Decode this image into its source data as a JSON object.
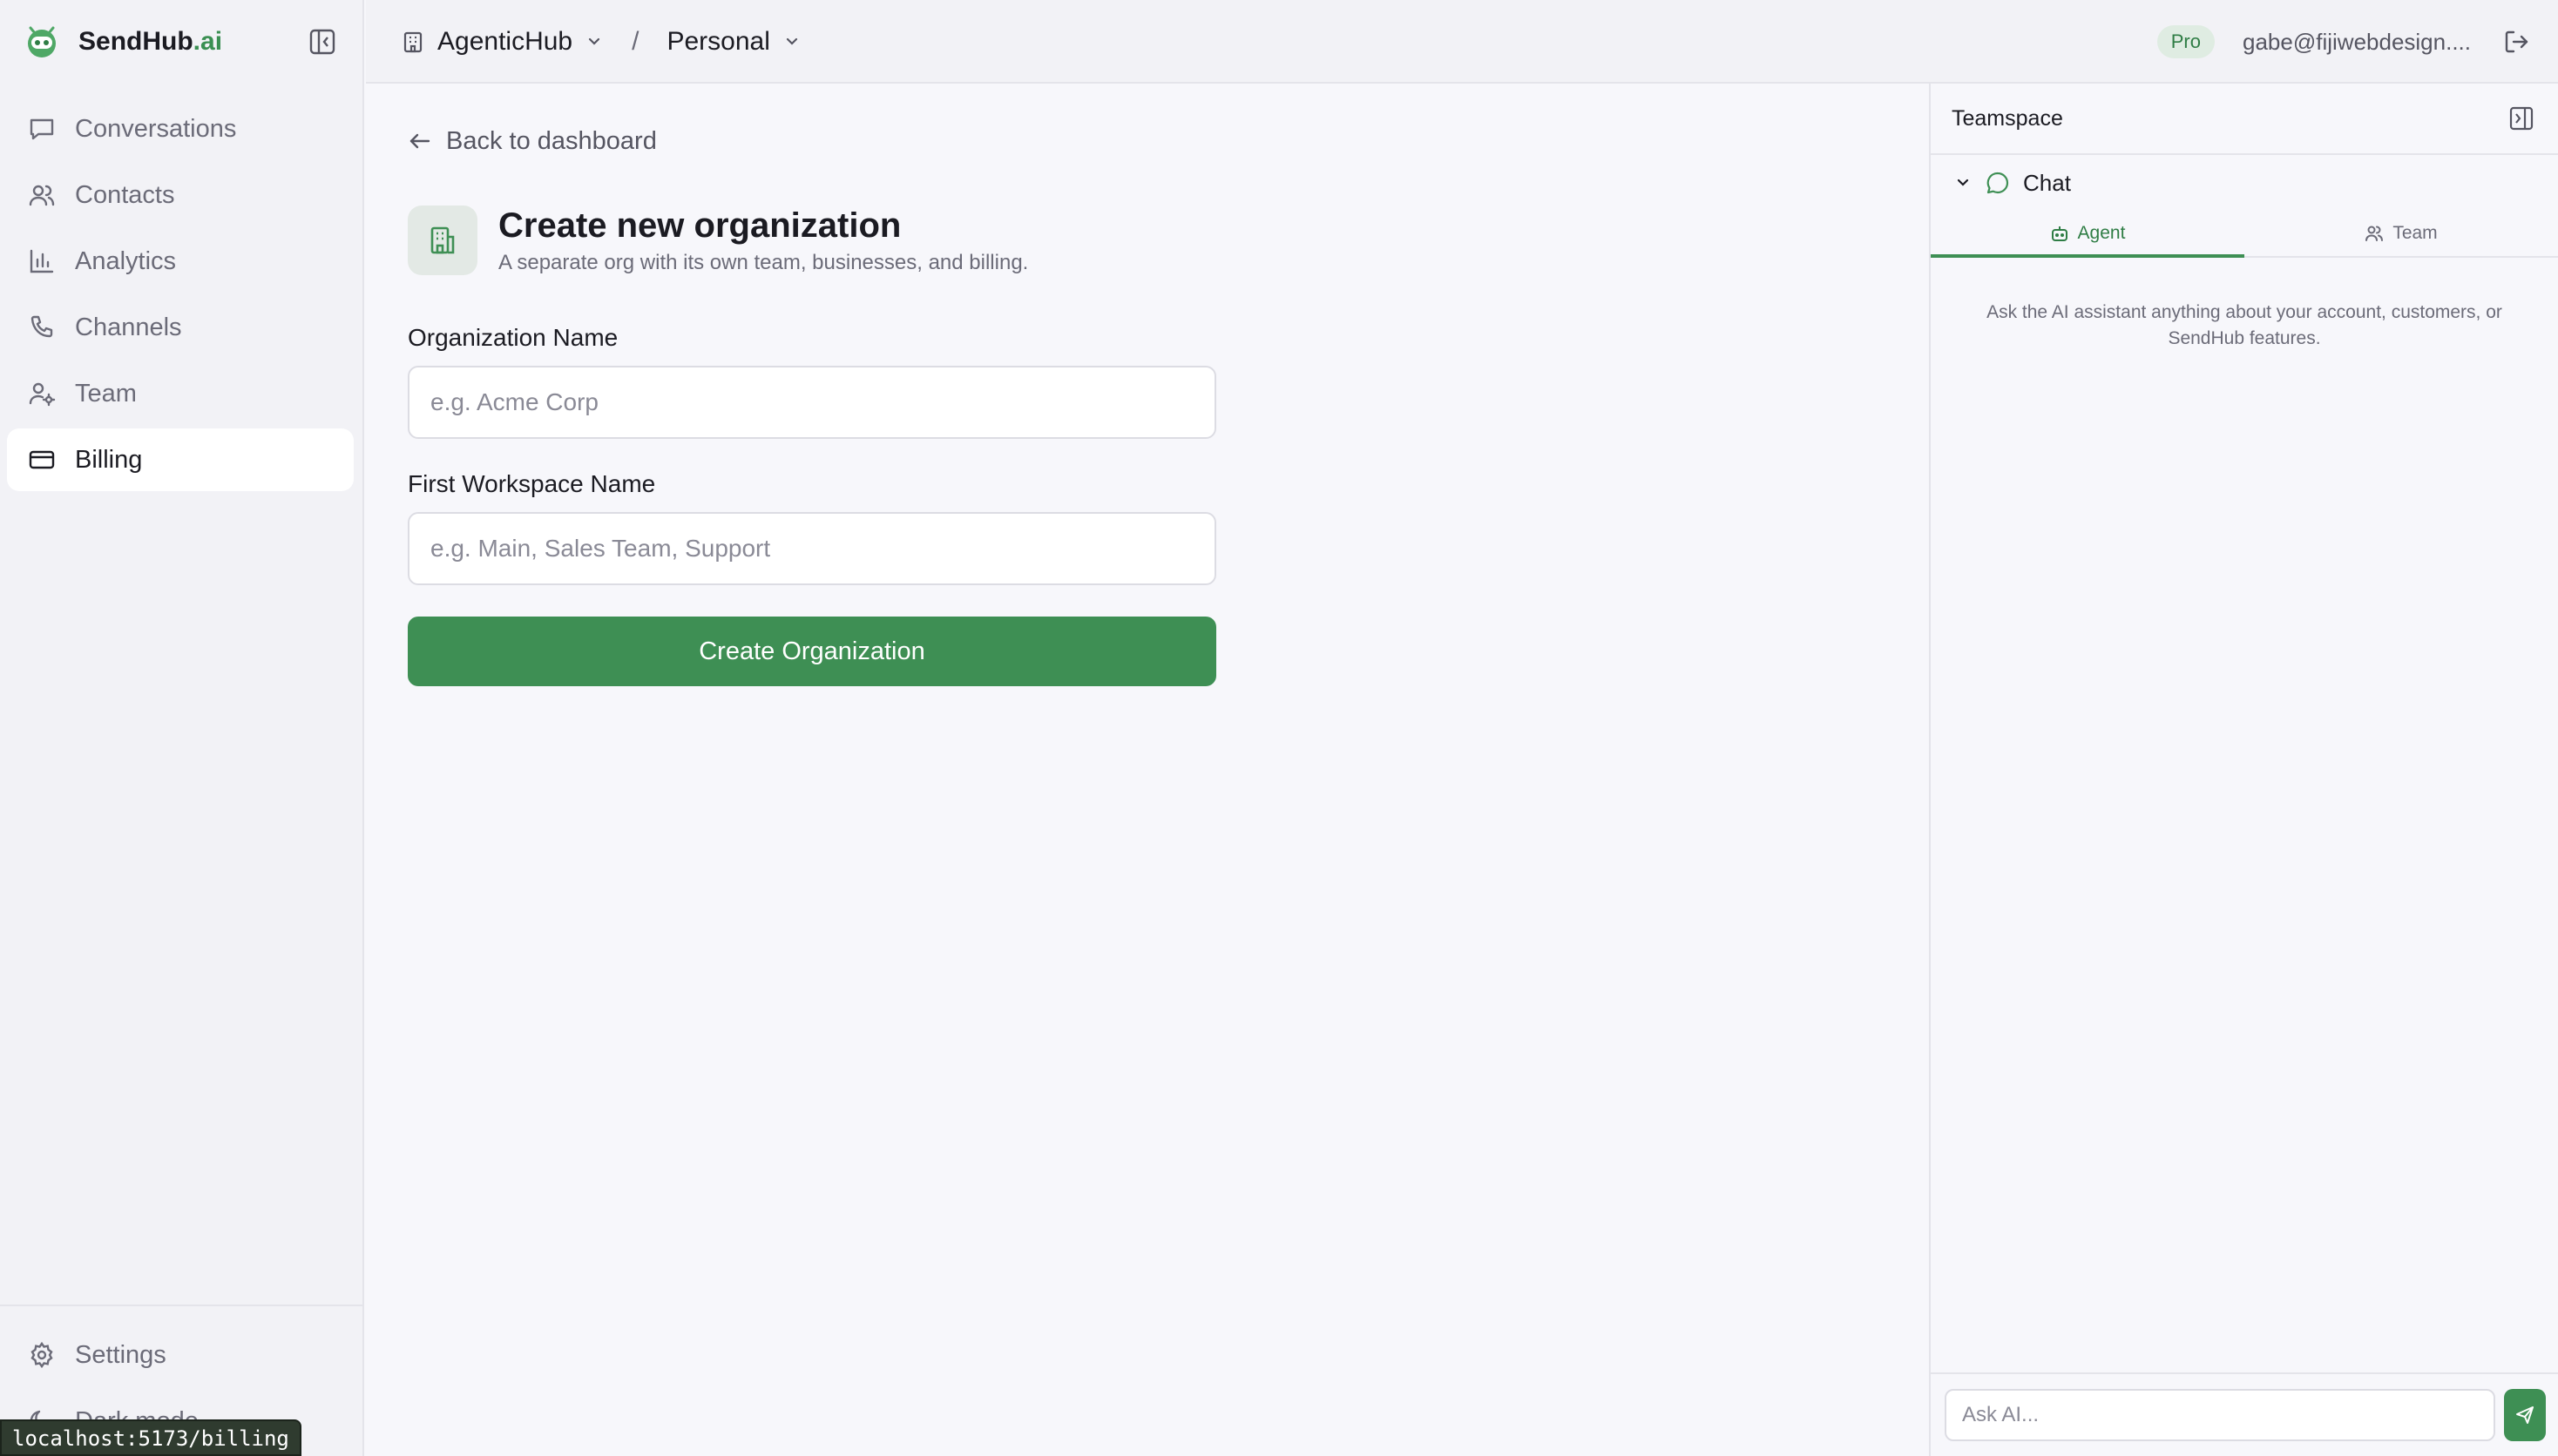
{
  "brand": {
    "name": "SendHub",
    "tld": ".ai"
  },
  "sidebar": {
    "items": [
      {
        "label": "Conversations",
        "icon": "message-icon"
      },
      {
        "label": "Contacts",
        "icon": "users-icon"
      },
      {
        "label": "Analytics",
        "icon": "bar-chart-icon"
      },
      {
        "label": "Channels",
        "icon": "phone-icon"
      },
      {
        "label": "Team",
        "icon": "user-cog-icon"
      },
      {
        "label": "Billing",
        "icon": "credit-card-icon",
        "active": true
      }
    ],
    "bottom": [
      {
        "label": "Settings",
        "icon": "gear-icon"
      },
      {
        "label": "Dark mode",
        "icon": "moon-icon"
      }
    ]
  },
  "status_url": "localhost:5173/billing",
  "topbar": {
    "org": "AgenticHub",
    "separator": "/",
    "workspace": "Personal",
    "plan_badge": "Pro",
    "user_email": "gabe@fijiwebdesign...."
  },
  "main": {
    "back_label": "Back to dashboard",
    "title": "Create new organization",
    "subtitle": "A separate org with its own team, businesses, and billing.",
    "fields": [
      {
        "label": "Organization Name",
        "value": "",
        "placeholder": "e.g. Acme Corp"
      },
      {
        "label": "First Workspace Name",
        "value": "",
        "placeholder": "e.g. Main, Sales Team, Support"
      }
    ],
    "submit_label": "Create Organization"
  },
  "panel": {
    "title": "Teamspace",
    "section": "Chat",
    "tabs": [
      {
        "label": "Agent",
        "icon": "bot-icon",
        "active": true
      },
      {
        "label": "Team",
        "icon": "users-icon",
        "active": false
      }
    ],
    "hint": "Ask the AI assistant anything about your account, customers, or SendHub features.",
    "input_placeholder": "Ask AI..."
  },
  "colors": {
    "accent": "#3e8f54",
    "accent_text": "#2f7d45",
    "sidebar_bg": "#f2f2f6",
    "page_bg": "#f7f7fb"
  }
}
